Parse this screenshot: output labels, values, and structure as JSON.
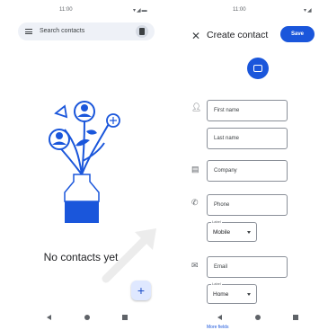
{
  "left": {
    "time": "11:00",
    "search_placeholder": "Search contacts",
    "empty_message": "No contacts yet",
    "fab_label": "+"
  },
  "right": {
    "time": "11:00",
    "title": "Create contact",
    "save_label": "Save",
    "fields": {
      "first_name": "First name",
      "last_name": "Last name",
      "company": "Company",
      "phone": "Phone",
      "phone_label_caption": "Label",
      "phone_label_value": "Mobile",
      "email": "Email",
      "email_label_caption": "Label",
      "email_label_value": "Home"
    },
    "more_fields": "More fields"
  },
  "colors": {
    "accent": "#1a56db",
    "illustration": "#1a56db",
    "search_bg": "#eef1f7"
  },
  "icons": [
    "menu-icon",
    "account-icon",
    "close-icon",
    "add-photo-icon",
    "person-icon",
    "company-icon",
    "phone-icon",
    "email-icon",
    "back-icon",
    "home-icon",
    "recents-icon"
  ]
}
